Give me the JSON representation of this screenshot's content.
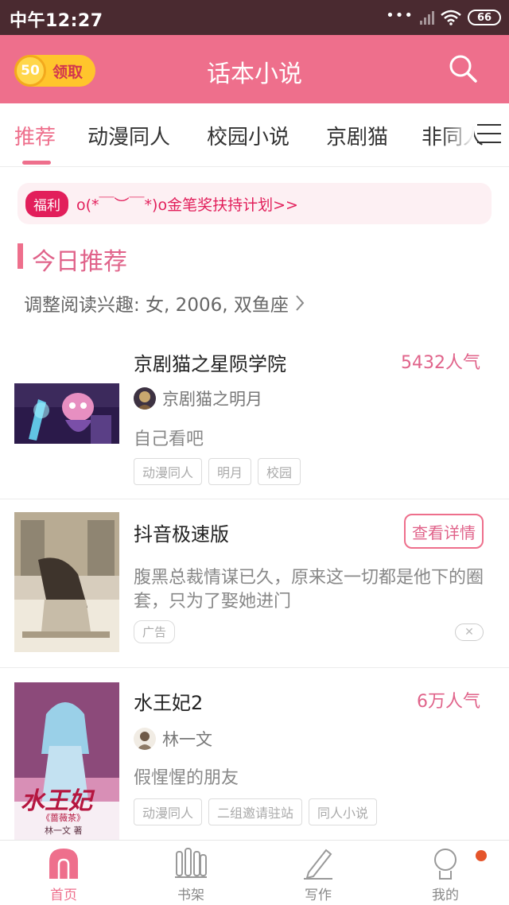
{
  "status_bar": {
    "time": "中午12:27",
    "battery": "66",
    "dots": "•••"
  },
  "header": {
    "title": "话本小说",
    "coin_value": "50",
    "coin_label": "领取"
  },
  "tabs": [
    {
      "label": "推荐",
      "active": true
    },
    {
      "label": "动漫同人"
    },
    {
      "label": "校园小说"
    },
    {
      "label": "京剧猫"
    },
    {
      "label": "非同人"
    }
  ],
  "banner": {
    "tag": "福利",
    "text": "o(*￣︶￣*)o金笔奖扶持计划>>"
  },
  "section": {
    "title": "今日推荐",
    "interest": "调整阅读兴趣: 女, 2006, 双鱼座"
  },
  "books": [
    {
      "title": "京剧猫之星陨学院",
      "popularity": "5432人气",
      "author": "京剧猫之明月",
      "description": "自己看吧",
      "tags": [
        "动漫同人",
        "明月",
        "校园"
      ]
    },
    {
      "title": "抖音极速版",
      "button": "查看详情",
      "description": "腹黑总裁情谋已久，原来这一切都是他下的圈套，只为了娶她进门",
      "ad_tag": "广告",
      "close": "✕"
    },
    {
      "title": "水王妃2",
      "popularity": "6万人气",
      "author": "林一文",
      "description": "假惺惺的朋友",
      "tags": [
        "动漫同人",
        "二组邀请驻站",
        "同人小说"
      ],
      "cover_text": "水王妃",
      "cover_subtitle": "《蔷薇茶》",
      "cover_author": "林一文 著"
    }
  ],
  "bottom_nav": [
    {
      "label": "首页",
      "icon": "home-icon",
      "active": true
    },
    {
      "label": "书架",
      "icon": "bookshelf-icon"
    },
    {
      "label": "写作",
      "icon": "pen-icon"
    },
    {
      "label": "我的",
      "icon": "profile-icon"
    }
  ],
  "colors": {
    "accent": "#ee6f8c",
    "status_bar": "#4a2a30",
    "coin": "#ffc52c",
    "banner_red": "#e21f5b"
  }
}
